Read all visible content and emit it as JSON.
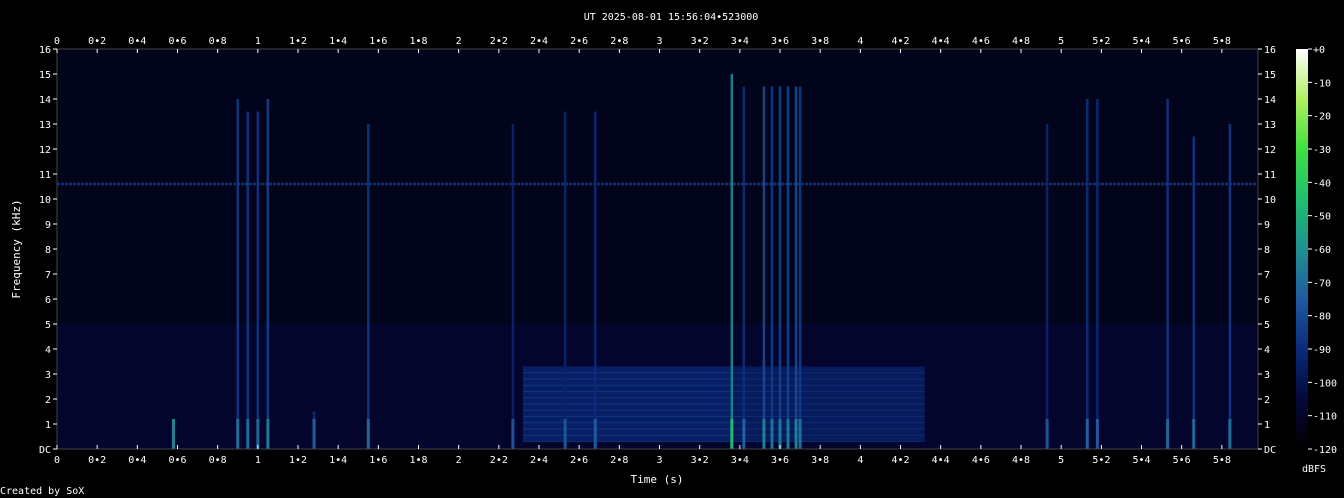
{
  "chart_data": {
    "type": "heatmap",
    "title": "UT 2025-08-01 15:56:04•523000",
    "xlabel": "Time (s)",
    "ylabel": "Frequency (kHz)",
    "colorbar_label": "dBFS",
    "footer": "Created by SoX",
    "xlim": [
      0,
      5.98
    ],
    "ylim": [
      0,
      16
    ],
    "zlim": [
      -120,
      0
    ],
    "x_ticks": [
      "0",
      "0•2",
      "0•4",
      "0•6",
      "0•8",
      "1",
      "1•2",
      "1•4",
      "1•6",
      "1•8",
      "2",
      "2•2",
      "2•4",
      "2•6",
      "2•8",
      "3",
      "3•2",
      "3•4",
      "3•6",
      "3•8",
      "4",
      "4•2",
      "4•4",
      "4•6",
      "4•8",
      "5",
      "5•2",
      "5•4",
      "5•6",
      "5•8"
    ],
    "y_ticks": [
      "DC",
      "1",
      "2",
      "3",
      "4",
      "5",
      "6",
      "7",
      "8",
      "9",
      "10",
      "11",
      "12",
      "13",
      "14",
      "15",
      "16"
    ],
    "colorbar_ticks": [
      "+0",
      "-10",
      "-20",
      "-30",
      "-40",
      "-50",
      "-60",
      "-70",
      "-80",
      "-90",
      "-100",
      "-110",
      "-120"
    ],
    "colormap": [
      "#000000",
      "#05083a",
      "#0a2a7a",
      "#1f5aa0",
      "#1f9090",
      "#20c070",
      "#40e040",
      "#b0f060",
      "#ffffff"
    ],
    "background_level_dbfs": -105,
    "tone": {
      "freq_khz": 10.6,
      "level_dbfs": -88
    },
    "burst_blocks": [
      {
        "t_start": 2.32,
        "t_end": 3.35,
        "f_low": 0.3,
        "f_high": 3.3,
        "level_dbfs": -92
      },
      {
        "t_start": 3.35,
        "t_end": 4.32,
        "f_low": 0.3,
        "f_high": 3.3,
        "level_dbfs": -95
      }
    ],
    "transients": [
      {
        "t": 0.58,
        "f_top": 1.2,
        "level_dbfs": -78
      },
      {
        "t": 0.9,
        "f_top": 14.0,
        "level_dbfs": -85
      },
      {
        "t": 0.95,
        "f_top": 13.5,
        "level_dbfs": -85
      },
      {
        "t": 1.0,
        "f_top": 13.5,
        "level_dbfs": -86
      },
      {
        "t": 1.05,
        "f_top": 14.0,
        "level_dbfs": -82
      },
      {
        "t": 1.28,
        "f_top": 1.5,
        "level_dbfs": -88
      },
      {
        "t": 1.55,
        "f_top": 13.0,
        "level_dbfs": -86
      },
      {
        "t": 2.27,
        "f_top": 13.0,
        "level_dbfs": -92
      },
      {
        "t": 2.53,
        "f_top": 13.5,
        "level_dbfs": -92
      },
      {
        "t": 2.68,
        "f_top": 13.5,
        "level_dbfs": -90
      },
      {
        "t": 3.36,
        "f_top": 15.0,
        "level_dbfs": -62
      },
      {
        "t": 3.42,
        "f_top": 14.5,
        "level_dbfs": -88
      },
      {
        "t": 3.52,
        "f_top": 14.5,
        "level_dbfs": -80
      },
      {
        "t": 3.56,
        "f_top": 14.5,
        "level_dbfs": -84
      },
      {
        "t": 3.6,
        "f_top": 14.5,
        "level_dbfs": -82
      },
      {
        "t": 3.64,
        "f_top": 14.5,
        "level_dbfs": -82
      },
      {
        "t": 3.68,
        "f_top": 14.5,
        "level_dbfs": -80
      },
      {
        "t": 3.7,
        "f_top": 14.5,
        "level_dbfs": -84
      },
      {
        "t": 4.93,
        "f_top": 13.0,
        "level_dbfs": -92
      },
      {
        "t": 5.13,
        "f_top": 14.0,
        "level_dbfs": -88
      },
      {
        "t": 5.18,
        "f_top": 14.0,
        "level_dbfs": -90
      },
      {
        "t": 5.53,
        "f_top": 14.0,
        "level_dbfs": -86
      },
      {
        "t": 5.66,
        "f_top": 12.5,
        "level_dbfs": -86
      },
      {
        "t": 5.84,
        "f_top": 13.0,
        "level_dbfs": -85
      }
    ]
  }
}
